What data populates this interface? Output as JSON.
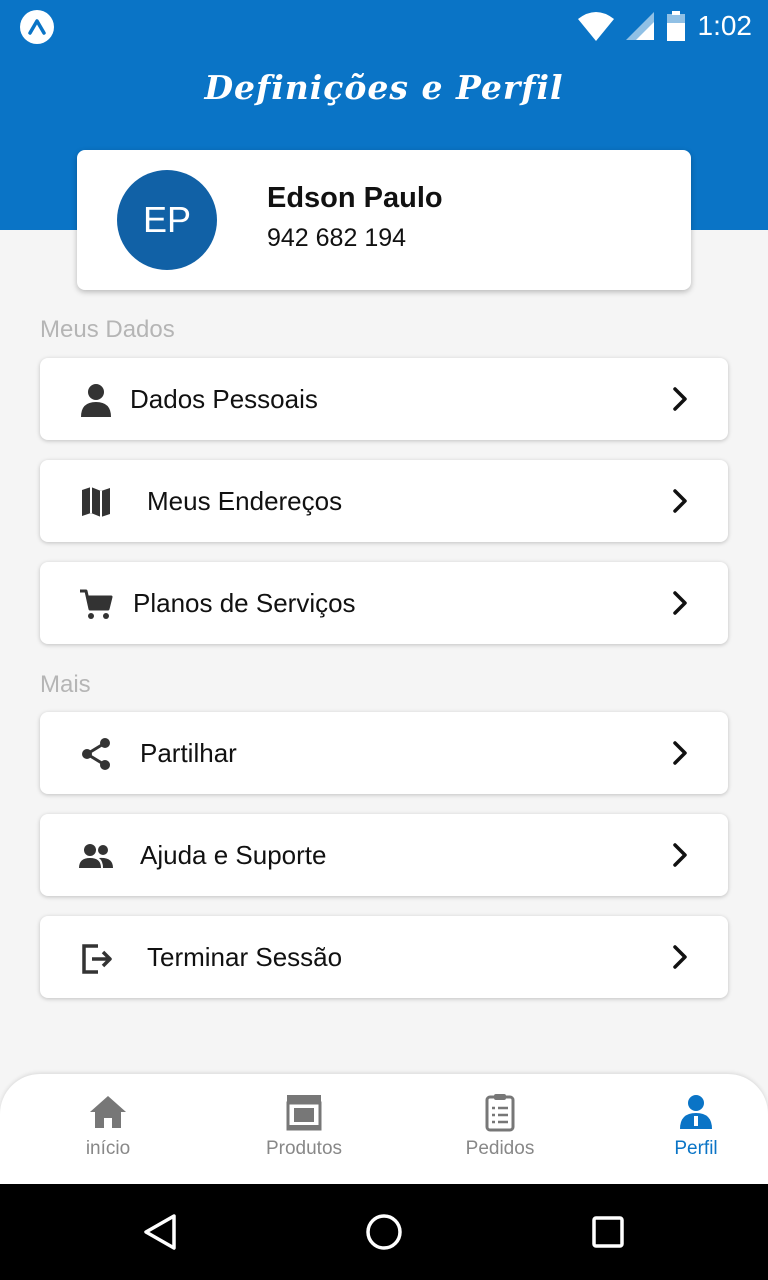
{
  "status": {
    "time": "1:02"
  },
  "header": {
    "title": "Definições e Perfil"
  },
  "profile": {
    "initials": "EP",
    "name": "Edson Paulo",
    "phone": "942 682 194"
  },
  "sections": {
    "my_data": "Meus Dados",
    "more": "Mais"
  },
  "menu": [
    {
      "label": "Dados Pessoais",
      "icon": "person-icon"
    },
    {
      "label": "Meus Endereços",
      "icon": "map-icon"
    },
    {
      "label": "Planos de Serviços",
      "icon": "cart-icon"
    },
    {
      "label": "Partilhar",
      "icon": "share-icon"
    },
    {
      "label": "Ajuda e Suporte",
      "icon": "people-icon"
    },
    {
      "label": "Terminar Sessão",
      "icon": "logout-icon"
    }
  ],
  "bottom_nav": [
    {
      "label": "início",
      "icon": "home-icon",
      "active": false
    },
    {
      "label": "Produtos",
      "icon": "store-icon",
      "active": false
    },
    {
      "label": "Pedidos",
      "icon": "clipboard-icon",
      "active": false
    },
    {
      "label": "Perfil",
      "icon": "user-icon",
      "active": true
    }
  ],
  "colors": {
    "primary": "#0a74c6",
    "avatar": "#1161a6",
    "inactive": "#888888"
  }
}
